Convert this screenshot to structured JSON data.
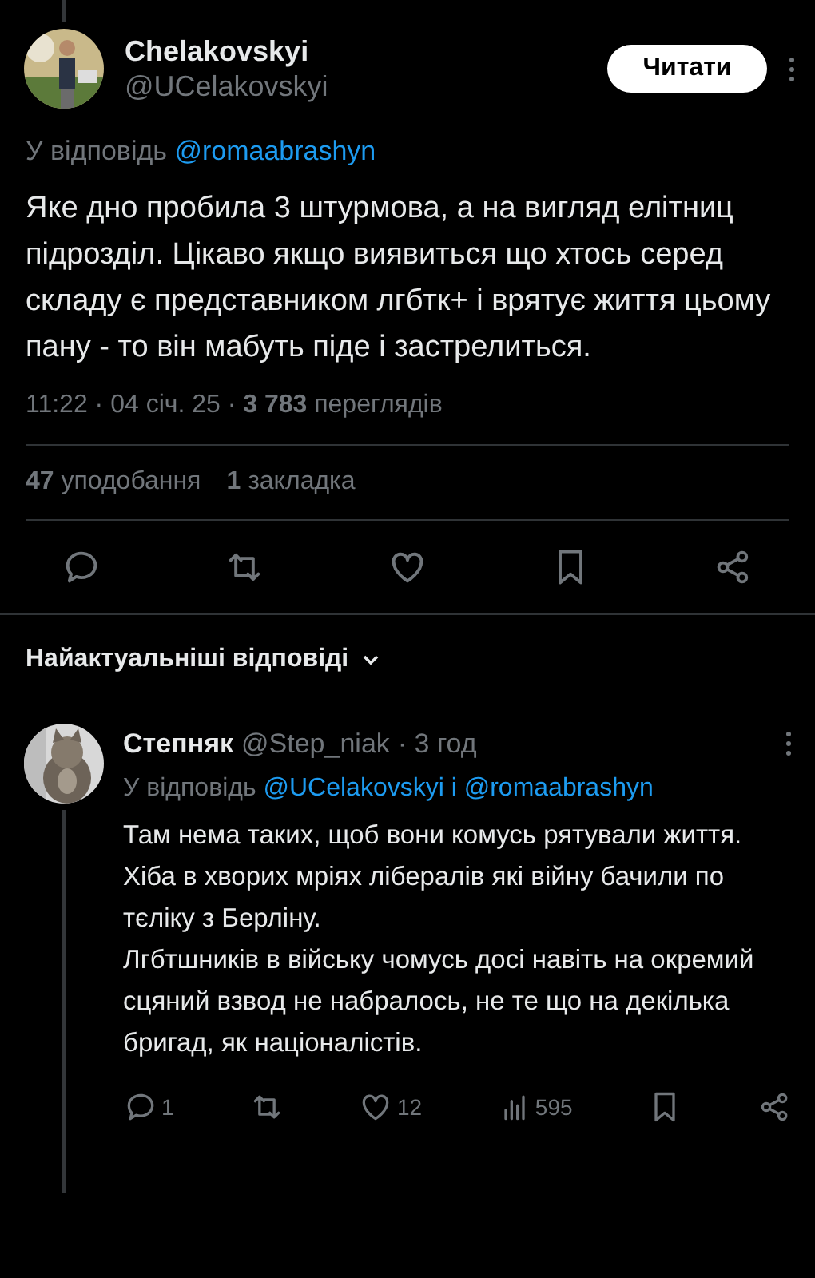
{
  "tweet": {
    "name": "Chelakovskyi",
    "handle": "@UCelakovskyi",
    "follow_button": "Читати",
    "reply_to": {
      "prefix": "У відповідь",
      "mentions": [
        "@romaabrashyn"
      ]
    },
    "text": "Яке дно пробила 3 штурмова, а на вигляд елітниц підрозділ. Цікаво якщо виявиться що хтось серед складу є представником лгбтк+ і врятує життя цьому пану - то він мабуть піде і застрелиться.",
    "meta": "11:22 · 04 січ. 25 · **3 783** переглядів",
    "stats": [
      "**47** уподобання",
      "**1** закладка"
    ],
    "actions": [
      {
        "kind": "reply"
      },
      {
        "kind": "repost"
      },
      {
        "kind": "like"
      },
      {
        "kind": "bookmark"
      },
      {
        "kind": "share"
      }
    ]
  },
  "replies_header": {
    "label": "Найактуальніші відповіді"
  },
  "replies": [
    {
      "name": "Степняк",
      "handle": "@Step_niak",
      "time": "· 3 год",
      "reply_to": {
        "prefix": "У відповідь",
        "mentions": [
          "@UCelakovskyi",
          "@romaabrashyn"
        ],
        "joiner": "і"
      },
      "paragraphs": [
        "Там нема таких, щоб вони комусь рятували життя.",
        "Хіба в хворих мріях лібералів які війну бачили по тєліку з Берліну.",
        "Лгбтшників в війську чомусь досі навіть на окремий сцяний взвод не набралось, не те що на декілька бригад, як націоналістів."
      ],
      "actions": [
        {
          "kind": "reply",
          "count": "1"
        },
        {
          "kind": "repost"
        },
        {
          "kind": "like",
          "count": "12"
        },
        {
          "kind": "views",
          "count": "595"
        },
        {
          "kind": "bookmark"
        },
        {
          "kind": "share"
        }
      ]
    }
  ]
}
